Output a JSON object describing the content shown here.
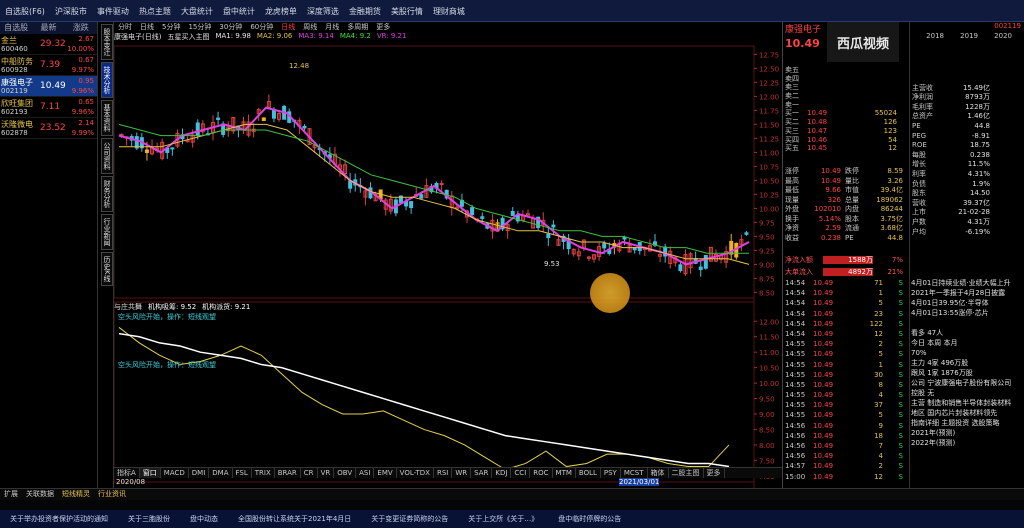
{
  "top_menu": [
    "自选股(F6)",
    "沪深股市",
    "事件驱动",
    "热点主题",
    "大盘统计",
    "盘中统计",
    "龙虎榜单",
    "深度筛选",
    "金融期货",
    "美股行情",
    "理财商城"
  ],
  "chart_tabs": [
    "分时",
    "日线",
    "5分钟",
    "15分钟",
    "30分钟",
    "60分钟",
    "日线",
    "周线",
    "月线",
    "多周期",
    "更多"
  ],
  "stocks": [
    {
      "name": "金兰",
      "code": "600460",
      "price": "29.32",
      "pct": "2.67",
      "pct2": "10.00%"
    },
    {
      "name": "中船防务",
      "code": "600928",
      "price": "7.39",
      "pct": "0.67",
      "pct2": "9.97%"
    },
    {
      "name": "康强电子",
      "code": "002119",
      "price": "10.49",
      "pct": "0.95",
      "pct2": "9.96%"
    },
    {
      "name": "欣旺集团",
      "code": "602193",
      "price": "7.11",
      "pct": "0.65",
      "pct2": "9.96%"
    },
    {
      "name": "沃隆微电",
      "code": "602878",
      "price": "23.52",
      "pct": "2.14",
      "pct2": "9.99%"
    }
  ],
  "list_head": [
    "自选股",
    "最新",
    "涨跌"
  ],
  "vtabs": [
    "股本变迁",
    "技术分析",
    "基本资料",
    "公司资料",
    "财务分析",
    "行业新闻",
    "历史K线"
  ],
  "chart": {
    "title": "康强电子(日线)",
    "indicator": "五星买入主图",
    "ma1_label": "MA1: 9.98",
    "ma2_label": "MA2: 9.06",
    "ma3_label": "MA3: 9.14",
    "ma4_label": "MA4: 9.2",
    "ma5_label": "VR: 9.21",
    "sub_indicator": "与庄共舞",
    "sub_label1": "机构吸筹: 9.52",
    "sub_label2": "机构派货: 9.21",
    "high_label": "12.48",
    "low_label": "9.53",
    "date_start": "2020/08",
    "date_mid": "2021/03/01"
  },
  "chart_data": [
    {
      "type": "line",
      "title": "康强电子(日线)",
      "y_ticks": [
        "12.75",
        "12.50",
        "12.25",
        "12.00",
        "11.75",
        "11.50",
        "11.25",
        "11.00",
        "10.75",
        "10.50",
        "10.25",
        "10.00",
        "9.75",
        "9.50",
        "9.25",
        "9.00",
        "8.75",
        "8.50"
      ],
      "ylim": [
        8.4,
        12.9
      ],
      "series": [
        {
          "name": "MA1",
          "values": [
            11.3,
            11.2,
            11.0,
            11.3,
            11.4,
            11.5,
            11.4,
            11.8,
            11.7,
            11.3,
            10.9,
            10.5,
            10.3,
            10.0,
            10.2,
            10.4,
            10.1,
            9.8,
            9.6,
            9.9,
            9.8,
            9.5,
            9.3,
            9.2,
            9.4,
            9.3,
            9.2,
            9.0,
            9.1,
            9.2,
            9.4
          ]
        },
        {
          "name": "MA2",
          "values": [
            11.1,
            11.1,
            11.1,
            11.2,
            11.3,
            11.4,
            11.5,
            11.5,
            11.4,
            11.1,
            10.8,
            10.5,
            10.3,
            10.2,
            10.2,
            10.1,
            10.0,
            9.8,
            9.7,
            9.6,
            9.6,
            9.5,
            9.4,
            9.4,
            9.3,
            9.3,
            9.2,
            9.1,
            9.1,
            9.1,
            9.0
          ]
        },
        {
          "name": "MA3",
          "values": [
            11.5,
            11.4,
            11.3,
            11.3,
            11.3,
            11.4,
            11.4,
            11.4,
            11.3,
            11.2,
            11.0,
            10.8,
            10.6,
            10.5,
            10.4,
            10.3,
            10.2,
            10.0,
            9.9,
            9.8,
            9.7,
            9.6,
            9.6,
            9.5,
            9.5,
            9.4,
            9.3,
            9.3,
            9.2,
            9.2,
            9.2
          ]
        }
      ]
    },
    {
      "type": "line",
      "title": "与庄共舞",
      "y_ticks": [
        "12.00",
        "11.50",
        "11.00",
        "10.50",
        "10.00",
        "9.50",
        "9.00",
        "8.50",
        "8.00",
        "7.50",
        "7.00"
      ],
      "ylim": [
        6.8,
        12.3
      ],
      "series": [
        {
          "name": "机构吸筹",
          "values": [
            11.8,
            11.3,
            10.9,
            10.6,
            10.7,
            10.9,
            11.2,
            10.9,
            10.3,
            9.7,
            9.3,
            9.0,
            9.0,
            9.1,
            8.8,
            8.5,
            8.3,
            8.0,
            7.6,
            7.2,
            7.4,
            7.8,
            7.3,
            7.4,
            7.7,
            7.7,
            7.6,
            7.4,
            7.3,
            7.3,
            8.0
          ]
        },
        {
          "name": "机构派货",
          "values": [
            11.6,
            11.5,
            11.3,
            11.2,
            11.0,
            10.9,
            10.8,
            10.6,
            10.5,
            10.3,
            10.1,
            9.9,
            9.7,
            9.5,
            9.3,
            9.1,
            8.9,
            8.7,
            8.5,
            8.3,
            8.2,
            8.1,
            8.0,
            7.9,
            7.8,
            7.7,
            7.6,
            7.5,
            7.4,
            7.4,
            7.3
          ]
        }
      ]
    }
  ],
  "annotations": {
    "a1": "空头风险开始，操作：短线观望",
    "a2": "空头风险开始，操作：短线观望"
  },
  "indicator_tabs": [
    "指标A",
    "窗口",
    "MACD",
    "DMI",
    "DMA",
    "FSL",
    "TRIX",
    "BRAR",
    "CR",
    "VR",
    "OBV",
    "ASI",
    "EMV",
    "VOL-TDX",
    "RSI",
    "WR",
    "SAR",
    "KDJ",
    "CCI",
    "ROC",
    "MTM",
    "BOLL",
    "PSY",
    "MCST",
    "箱体",
    "二股主图",
    "更多"
  ],
  "bottom2": [
    "扩展",
    "关联数据",
    "短线精灵",
    "行业资讯"
  ],
  "ticker": [
    "关于举办投资者保护活动的通知",
    "关于三胞股份",
    "盘中动态",
    "全国股份转让系统关于2021年4月日",
    "关于变更证券简称的公告",
    "关于上交所《关于…》",
    "盘中临时停牌的公告"
  ],
  "right": {
    "name": "康强电子",
    "code": "002119",
    "price": "10.49",
    "orderbook": [
      {
        "label": "卖五",
        "price": "",
        "vol": ""
      },
      {
        "label": "卖四",
        "price": "",
        "vol": ""
      },
      {
        "label": "卖三",
        "price": "",
        "vol": ""
      },
      {
        "label": "卖二",
        "price": "",
        "vol": ""
      },
      {
        "label": "卖一",
        "price": "",
        "vol": ""
      },
      {
        "label": "买一",
        "price": "10.49",
        "vol": "55024"
      },
      {
        "label": "买二",
        "price": "10.48",
        "vol": "126"
      },
      {
        "label": "买三",
        "price": "10.47",
        "vol": "123"
      },
      {
        "label": "买四",
        "price": "10.46",
        "vol": "54"
      },
      {
        "label": "买五",
        "price": "10.45",
        "vol": "12"
      }
    ],
    "stats": [
      {
        "k": "涨停",
        "v": "10.49",
        "k2": "跌停",
        "v2": "8.59"
      },
      {
        "k": "最高",
        "v": "10.49",
        "k2": "量比",
        "v2": "3.26"
      },
      {
        "k": "最低",
        "v": "9.66",
        "k2": "市值",
        "v2": "39.4亿"
      },
      {
        "k": "现量",
        "v": "326",
        "k2": "总量",
        "v2": "189062"
      },
      {
        "k": "外盘",
        "v": "102010",
        "k2": "内盘",
        "v2": "86244"
      },
      {
        "k": "换手",
        "v": "5.14%",
        "k2": "股本",
        "v2": "3.75亿"
      },
      {
        "k": "净资",
        "v": "2.59",
        "k2": "流通",
        "v2": "3.68亿"
      },
      {
        "k": "收益",
        "v": "0.238",
        "k2": "PE",
        "v2": "44.8"
      }
    ],
    "flow": [
      {
        "k": "净流入额",
        "v": "1588万",
        "p": "7%"
      },
      {
        "k": "大单流入",
        "v": "4892万",
        "p": "21%"
      }
    ],
    "trades": [
      {
        "t": "14:54",
        "p": "10.49",
        "q": "71",
        "s": "S"
      },
      {
        "t": "14:54",
        "p": "10.49",
        "q": "1",
        "s": "S"
      },
      {
        "t": "14:54",
        "p": "10.49",
        "q": "5",
        "s": "S"
      },
      {
        "t": "14:54",
        "p": "10.49",
        "q": "23",
        "s": "S"
      },
      {
        "t": "14:54",
        "p": "10.49",
        "q": "122",
        "s": "S"
      },
      {
        "t": "14:54",
        "p": "10.49",
        "q": "12",
        "s": "S"
      },
      {
        "t": "14:55",
        "p": "10.49",
        "q": "2",
        "s": "S"
      },
      {
        "t": "14:55",
        "p": "10.49",
        "q": "5",
        "s": "S"
      },
      {
        "t": "14:55",
        "p": "10.49",
        "q": "1",
        "s": "S"
      },
      {
        "t": "14:55",
        "p": "10.49",
        "q": "30",
        "s": "S"
      },
      {
        "t": "14:55",
        "p": "10.49",
        "q": "8",
        "s": "S"
      },
      {
        "t": "14:55",
        "p": "10.49",
        "q": "4",
        "s": "S"
      },
      {
        "t": "14:55",
        "p": "10.49",
        "q": "37",
        "s": "S"
      },
      {
        "t": "14:55",
        "p": "10.49",
        "q": "5",
        "s": "S"
      },
      {
        "t": "14:56",
        "p": "10.49",
        "q": "9",
        "s": "S"
      },
      {
        "t": "14:56",
        "p": "10.49",
        "q": "18",
        "s": "S"
      },
      {
        "t": "14:56",
        "p": "10.49",
        "q": "7",
        "s": "S"
      },
      {
        "t": "14:56",
        "p": "10.49",
        "q": "4",
        "s": "S"
      },
      {
        "t": "14:57",
        "p": "10.49",
        "q": "2",
        "s": "S"
      },
      {
        "t": "15:00",
        "p": "10.49",
        "q": "12",
        "s": "S"
      }
    ],
    "fin_years": [
      "2018",
      "2019",
      "2020"
    ],
    "fin": [
      {
        "k": "主营收",
        "v": "15.49亿"
      },
      {
        "k": "净利润",
        "v": "8793万"
      },
      {
        "k": "毛利率",
        "v": "1228万"
      },
      {
        "k": "总资产",
        "v": "1.46亿"
      },
      {
        "k": "PE",
        "v": "44.8"
      },
      {
        "k": "PEG",
        "v": "-8.91"
      },
      {
        "k": "ROE",
        "v": "18.75"
      },
      {
        "k": "每股",
        "v": "0.238"
      },
      {
        "k": "增长",
        "v": "11.5%"
      },
      {
        "k": "利率",
        "v": "4.31%"
      },
      {
        "k": "负债",
        "v": "1.9%"
      },
      {
        "k": "股东",
        "v": "14.50"
      },
      {
        "k": "营收",
        "v": "39.37亿"
      },
      {
        "k": "上市",
        "v": "21-02-28"
      },
      {
        "k": "户数",
        "v": "4.31万"
      },
      {
        "k": "户均",
        "v": "-6.19%"
      }
    ],
    "news": [
      "4月01日持续业绩·业绩大幅上升",
      "2021年一季报于4月28日披露",
      "4月01日39.95亿·半导体",
      "4月01日13:55涨停·芯片",
      "",
      "看多 47人",
      "今日 本周 本月",
      "70%",
      "主力 4家 496万股",
      "跟风 1家 1876万股",
      "公司 宁波康强电子股份有限公司",
      "控股 无",
      "主营 制造和销售半导体封装材料",
      "地区 国内芯片封装材料领先",
      "指南详细 主题投资 选股策略",
      "2021年(预测)",
      "2022年(预测)"
    ]
  }
}
